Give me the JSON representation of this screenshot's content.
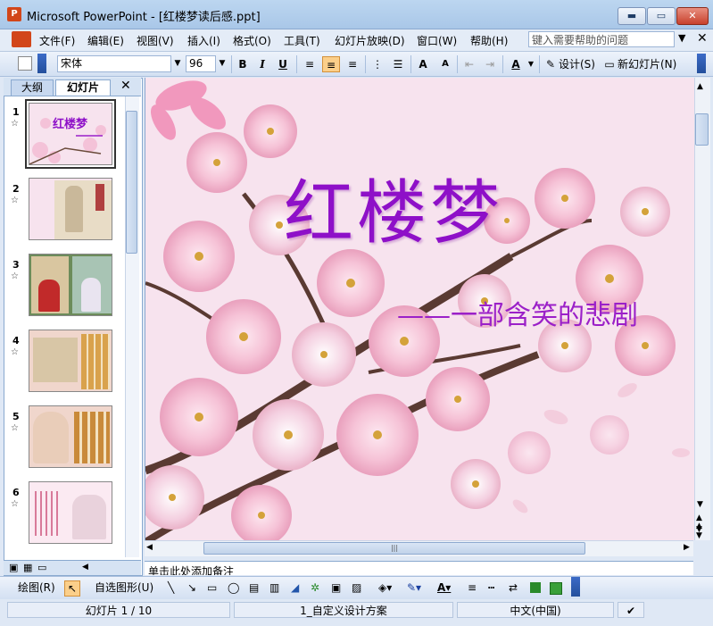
{
  "window": {
    "title": "Microsoft PowerPoint - [红楼梦读后感.ppt]",
    "app_icon_letter": "P",
    "minimize": "▬",
    "maximize": "▭",
    "close": "✕"
  },
  "menubar": {
    "items": [
      "文件(F)",
      "编辑(E)",
      "视图(V)",
      "插入(I)",
      "格式(O)",
      "工具(T)",
      "幻灯片放映(D)",
      "窗口(W)",
      "帮助(H)"
    ],
    "help_placeholder": "键入需要帮助的问题",
    "help_arrow": "▼",
    "close_doc": "✕"
  },
  "toolbar": {
    "font_name": "宋体",
    "font_size": "96",
    "bold": "B",
    "italic": "I",
    "underline": "U",
    "design_label": "设计(S)",
    "new_slide_label": "新幻灯片(N)"
  },
  "left_pane": {
    "tab_outline": "大纲",
    "tab_slides": "幻灯片",
    "close": "✕",
    "slide_numbers": [
      "1",
      "2",
      "3",
      "4",
      "5",
      "6"
    ],
    "star": "☆",
    "thumb1_title": "红楼梦"
  },
  "slide": {
    "title": "红楼梦",
    "subtitle": "——一部含笑的悲剧"
  },
  "notes": {
    "placeholder": "单击此处添加备注"
  },
  "drawbar": {
    "draw_label": "绘图(R)",
    "autoshapes_label": "自选图形(U)"
  },
  "statusbar": {
    "slide_info": "幻灯片 1 / 10",
    "design_template": "1_自定义设计方案",
    "language": "中文(中国)"
  },
  "colors": {
    "title": "#8e10c8",
    "slide_bg": "#f7e3ee",
    "chrome": "#dfe8f5"
  }
}
